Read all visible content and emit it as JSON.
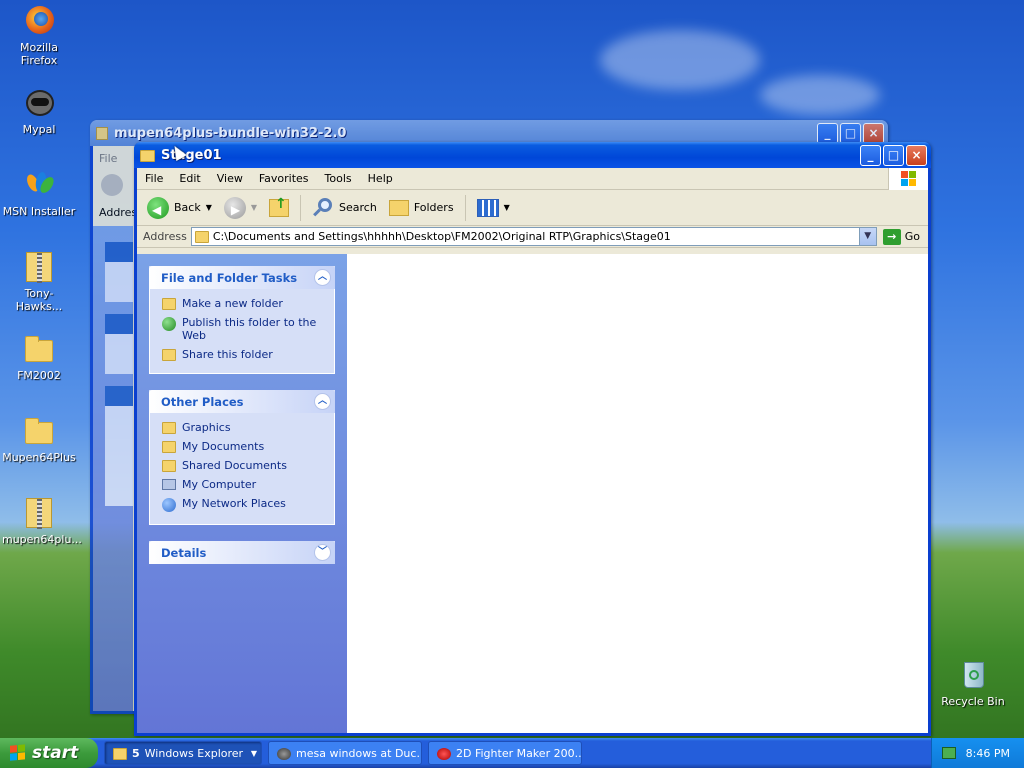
{
  "desktop": {
    "icons": [
      {
        "label": "Mozilla Firefox",
        "icon": "firefox-icon"
      },
      {
        "label": "Mypal",
        "icon": "mypal-icon"
      },
      {
        "label": "MSN Installer",
        "icon": "msn-icon"
      },
      {
        "label": "Tony-Hawks...",
        "icon": "zip-folder-icon"
      },
      {
        "label": "FM2002",
        "icon": "folder-icon"
      },
      {
        "label": "Mupen64Plus",
        "icon": "folder-icon"
      },
      {
        "label": "mupen64plu...",
        "icon": "zip-folder-icon"
      },
      {
        "label": "Recycle Bin",
        "icon": "recycle-bin-icon"
      }
    ]
  },
  "back_window": {
    "title": "mupen64plus-bundle-win32-2.0",
    "menu_file": "File",
    "address_label": "Addres"
  },
  "window": {
    "title": "Stage01",
    "menu": [
      "File",
      "Edit",
      "View",
      "Favorites",
      "Tools",
      "Help"
    ],
    "toolbar": {
      "back": "Back",
      "search": "Search",
      "folders": "Folders"
    },
    "address": {
      "label": "Address",
      "path": "C:\\Documents and Settings\\hhhhh\\Desktop\\FM2002\\Original RTP\\Graphics\\Stage01",
      "go": "Go"
    },
    "taskpane": {
      "tasks": {
        "title": "File and Folder Tasks",
        "items": [
          "Make a new folder",
          "Publish this folder to the Web",
          "Share this folder"
        ]
      },
      "places": {
        "title": "Other Places",
        "items": [
          "Graphics",
          "My Documents",
          "Shared Documents",
          "My Computer",
          "My Network Places"
        ]
      },
      "details": {
        "title": "Details"
      }
    }
  },
  "taskbar": {
    "start": "start",
    "items": [
      {
        "count": "5",
        "label": "Windows Explorer"
      },
      {
        "label": "mesa windows at Duc..."
      },
      {
        "label": "2D Fighter Maker 200..."
      }
    ],
    "clock": "8:46 PM"
  },
  "colors": {
    "titlebar": "#0047d8",
    "taskbar": "#245edb",
    "start": "#3c9b3c"
  }
}
